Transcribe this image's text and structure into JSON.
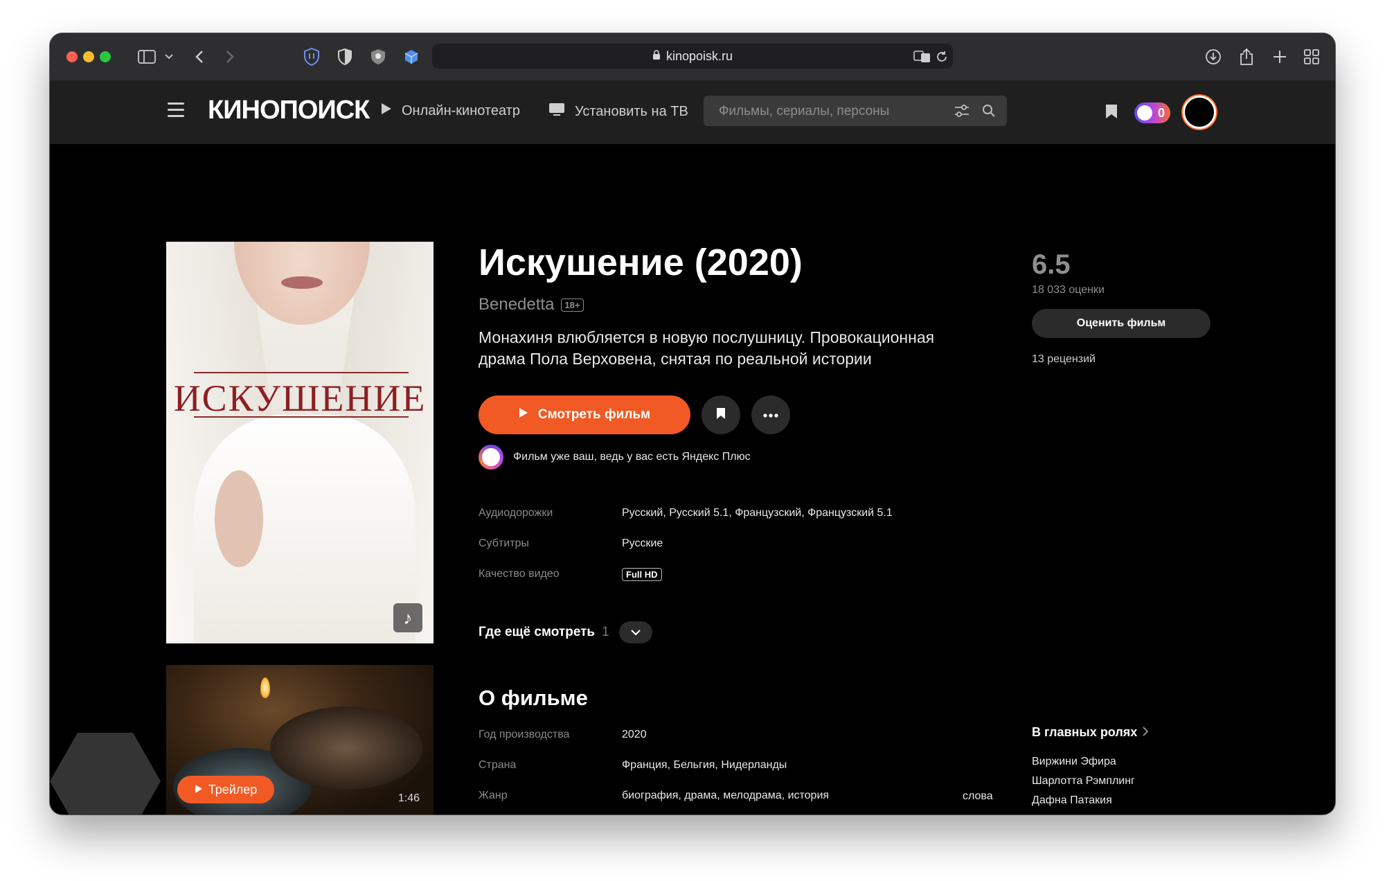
{
  "browser": {
    "url": "kinopoisk.ru"
  },
  "header": {
    "logo": "КИНОПОИСК",
    "nav": [
      "Онлайн-кинотеатр",
      "Установить на ТВ"
    ],
    "search_placeholder": "Фильмы, сериалы, персоны",
    "plus_count": "0"
  },
  "poster": {
    "title": "ИСКУШЕНИЕ"
  },
  "trailer": {
    "label": "Трейлер",
    "duration": "1:46"
  },
  "movie": {
    "title": "Искушение (2020)",
    "original_title": "Benedetta",
    "age": "18+",
    "tagline": "Монахиня влюбляется в новую послушницу. Провокационная драма Пола Верховена, снятая по реальной истории",
    "watch_label": "Смотреть фильм",
    "plus_note": "Фильм уже ваш, ведь у вас есть Яндекс Плюс"
  },
  "specs": [
    {
      "label": "Аудиодорожки",
      "value": "Русский, Русский 5.1, Французский, Французский 5.1"
    },
    {
      "label": "Субтитры",
      "value": "Русские"
    },
    {
      "label": "Качество видео",
      "value": "Full HD"
    }
  ],
  "where_else": {
    "label": "Где ещё смотреть",
    "count": "1"
  },
  "about": {
    "heading": "О фильме",
    "rows": [
      {
        "label": "Год производства",
        "value": "2020"
      },
      {
        "label": "Страна",
        "value": "Франция, Бельгия, Нидерланды"
      },
      {
        "label": "Жанр",
        "value": "биография, драма, мелодрама, история"
      }
    ],
    "words_link": "слова"
  },
  "rating": {
    "value": "6.5",
    "votes": "18 033 оценки",
    "rate_label": "Оценить фильм",
    "reviews": "13 рецензий"
  },
  "cast": {
    "heading": "В главных ролях",
    "names": [
      "Виржини Эфира",
      "Шарлотта Рэмплинг",
      "Дафна Патакия"
    ]
  },
  "colors": {
    "accent": "#f15a24",
    "background": "#000000",
    "header": "#1f1f1f"
  }
}
